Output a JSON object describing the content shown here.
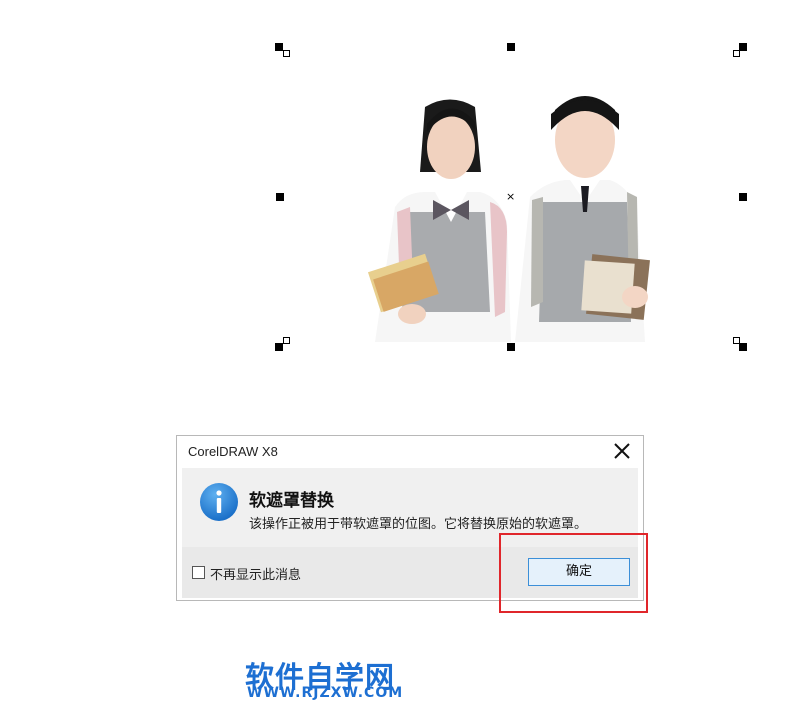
{
  "dialog": {
    "title": "CorelDRAW X8",
    "heading": "软遮罩替换",
    "message": "该操作正被用于带软遮罩的位图。它将替换原始的软遮罩。",
    "checkbox_label": "不再显示此消息",
    "checkbox_checked": false,
    "ok_label": "确定",
    "icon": "info-icon",
    "close_icon": "close-icon"
  },
  "watermark": {
    "name": "软件自学网",
    "url": "WWW.RJZXW.COM"
  },
  "colors": {
    "accent": "#1d6fd2",
    "highlight": "#e0262b",
    "info_icon": "#1a7ad3"
  }
}
